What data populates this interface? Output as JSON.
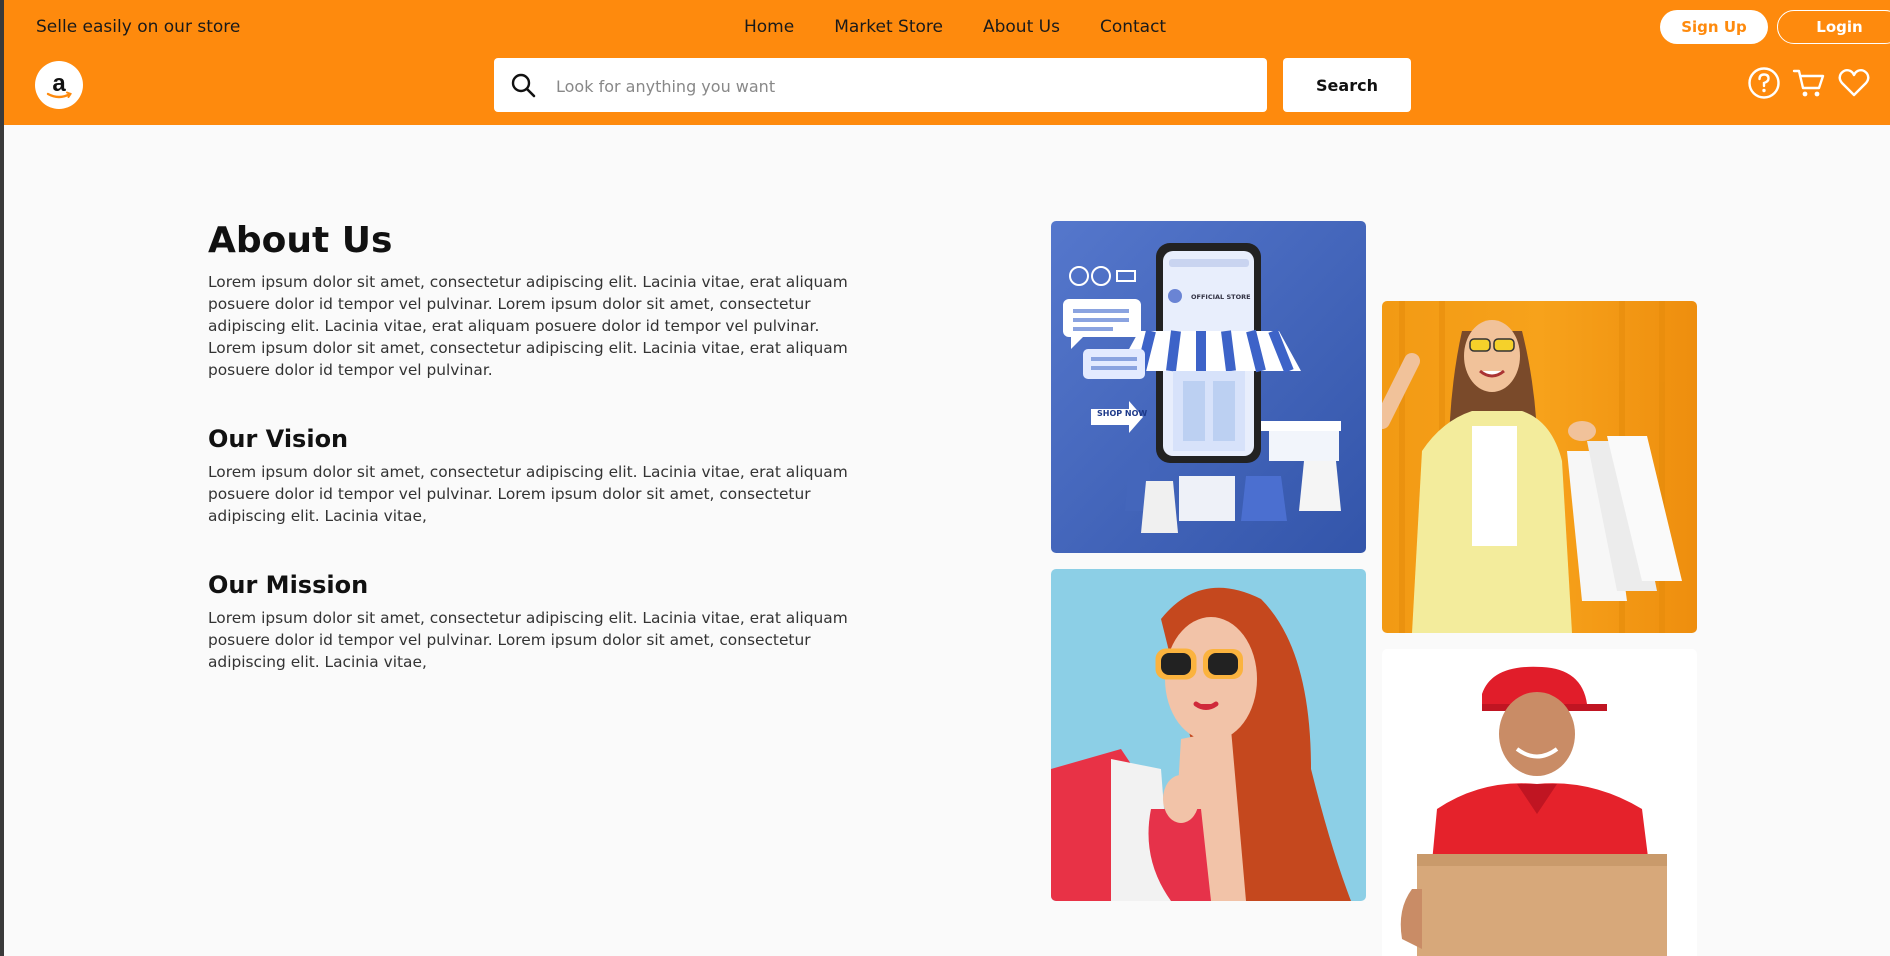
{
  "header": {
    "tagline": "Selle easily on our store",
    "nav": [
      "Home",
      "Market Store",
      "About Us",
      "Contact"
    ],
    "signup_label": "Sign Up",
    "login_label": "Login",
    "logo_letter": "a",
    "search_placeholder": "Look for anything you want",
    "search_button": "Search",
    "brand_color": "#fe8a0d"
  },
  "about": {
    "title": "About Us",
    "text": "Lorem ipsum dolor sit amet, consectetur adipiscing elit. Lacinia vitae, erat aliquam posuere dolor id tempor vel pulvinar. Lorem ipsum dolor sit amet, consectetur adipiscing elit. Lacinia vitae, erat aliquam posuere dolor id tempor vel pulvinar. Lorem ipsum dolor sit amet, consectetur adipiscing elit. Lacinia vitae, erat aliquam posuere dolor id tempor vel pulvinar."
  },
  "vision": {
    "title": "Our Vision",
    "text": "Lorem ipsum dolor sit amet, consectetur adipiscing elit. Lacinia vitae, erat aliquam posuere dolor id tempor vel pulvinar. Lorem ipsum dolor sit amet, consectetur adipiscing elit. Lacinia vitae,"
  },
  "mission": {
    "title": "Our Mission",
    "text": "Lorem ipsum dolor sit amet, consectetur adipiscing elit. Lacinia vitae, erat aliquam posuere dolor id tempor vel pulvinar. Lorem ipsum dolor sit amet, consectetur adipiscing elit. Lacinia vitae,"
  },
  "store_image": {
    "official_store": "OFFICIAL STORE",
    "shop_now": "SHOP NOW"
  }
}
